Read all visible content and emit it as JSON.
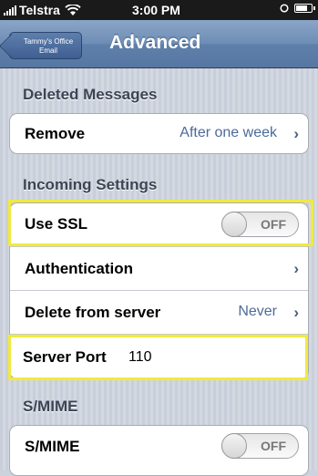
{
  "status_bar": {
    "carrier": "Telstra",
    "time": "3:00 PM",
    "icons": [
      "signal-icon",
      "wifi-icon",
      "alarm-icon",
      "battery-icon"
    ]
  },
  "nav": {
    "back_label": "Tammy's Office Email",
    "title": "Advanced"
  },
  "sections": {
    "deleted": {
      "header": "Deleted Messages",
      "remove_label": "Remove",
      "remove_value": "After one week"
    },
    "incoming": {
      "header": "Incoming Settings",
      "ssl_label": "Use SSL",
      "ssl_toggle": "OFF",
      "auth_label": "Authentication",
      "delete_label": "Delete from server",
      "delete_value": "Never",
      "port_label": "Server Port",
      "port_value": "110"
    },
    "smime": {
      "header": "S/MIME",
      "smime_label": "S/MIME",
      "smime_toggle": "OFF"
    }
  },
  "colors": {
    "highlight": "#f1ea3c",
    "nav_bar": "#6e8db4",
    "value_text": "#4c6a9a"
  }
}
